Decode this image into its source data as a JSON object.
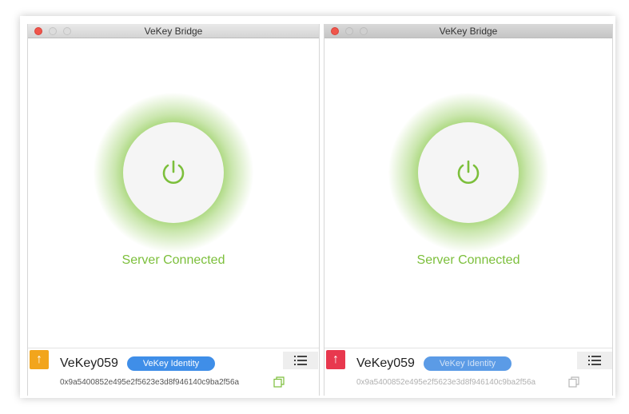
{
  "windows": [
    {
      "title": "VeKey Bridge",
      "status": "Server Connected",
      "account_name": "VeKey059",
      "identity_label": "VeKey Identity",
      "address": "0x9a5400852e495e2f5623e3d8f946140c9ba2f56a",
      "transfer_badge": "↑",
      "badge_color": "#f2a51c",
      "accent_color": "#7cbf3b"
    },
    {
      "title": "VeKey Bridge",
      "status": "Server Connected",
      "account_name": "VeKey059",
      "identity_label": "VeKey Identity",
      "address": "0x9a5400852e495e2f5623e3d8f946140c9ba2f56a",
      "transfer_badge": "↑",
      "badge_color": "#e8384e",
      "accent_color": "#7cbf3b"
    }
  ]
}
